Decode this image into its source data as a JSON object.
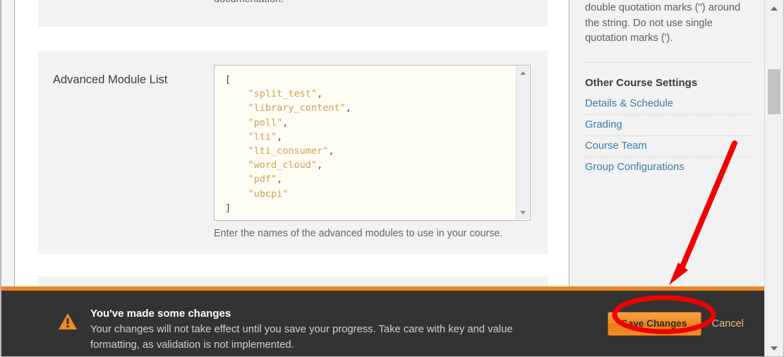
{
  "main": {
    "top_panel_tail_text": "documentation.",
    "advanced_module_list": {
      "label": "Advanced Module List",
      "value": "[\n    \"split_test\",\n    \"library_content\",\n    \"poll\",\n    \"lti\",\n    \"lti_consumer\",\n    \"word_cloud\",\n    \"pdf\",\n    \"ubcpi\"\n]",
      "modules": [
        "split_test",
        "library_content",
        "poll",
        "lti",
        "lti_consumer",
        "word_cloud",
        "pdf",
        "ubcpi"
      ],
      "help_text": "Enter the names of the advanced modules to use in your course."
    }
  },
  "sidebar": {
    "intro_paragraph": "double quotation marks (\") around the string. Do not use single quotation marks (').",
    "other_settings_heading": "Other Course Settings",
    "links": [
      {
        "label": "Details & Schedule"
      },
      {
        "label": "Grading"
      },
      {
        "label": "Course Team"
      },
      {
        "label": "Group Configurations"
      }
    ]
  },
  "notification": {
    "icon": "warning-triangle-icon",
    "title": "You've made some changes",
    "body": "Your changes will not take effect until you save your progress. Take care with key and value formatting, as validation is not implemented.",
    "save_label": "Save Changes",
    "cancel_label": "Cancel",
    "accent_color": "#ee8220",
    "background_color": "#333333"
  },
  "annotation": {
    "highlight_color": "#f20000",
    "target": "Save Changes"
  }
}
